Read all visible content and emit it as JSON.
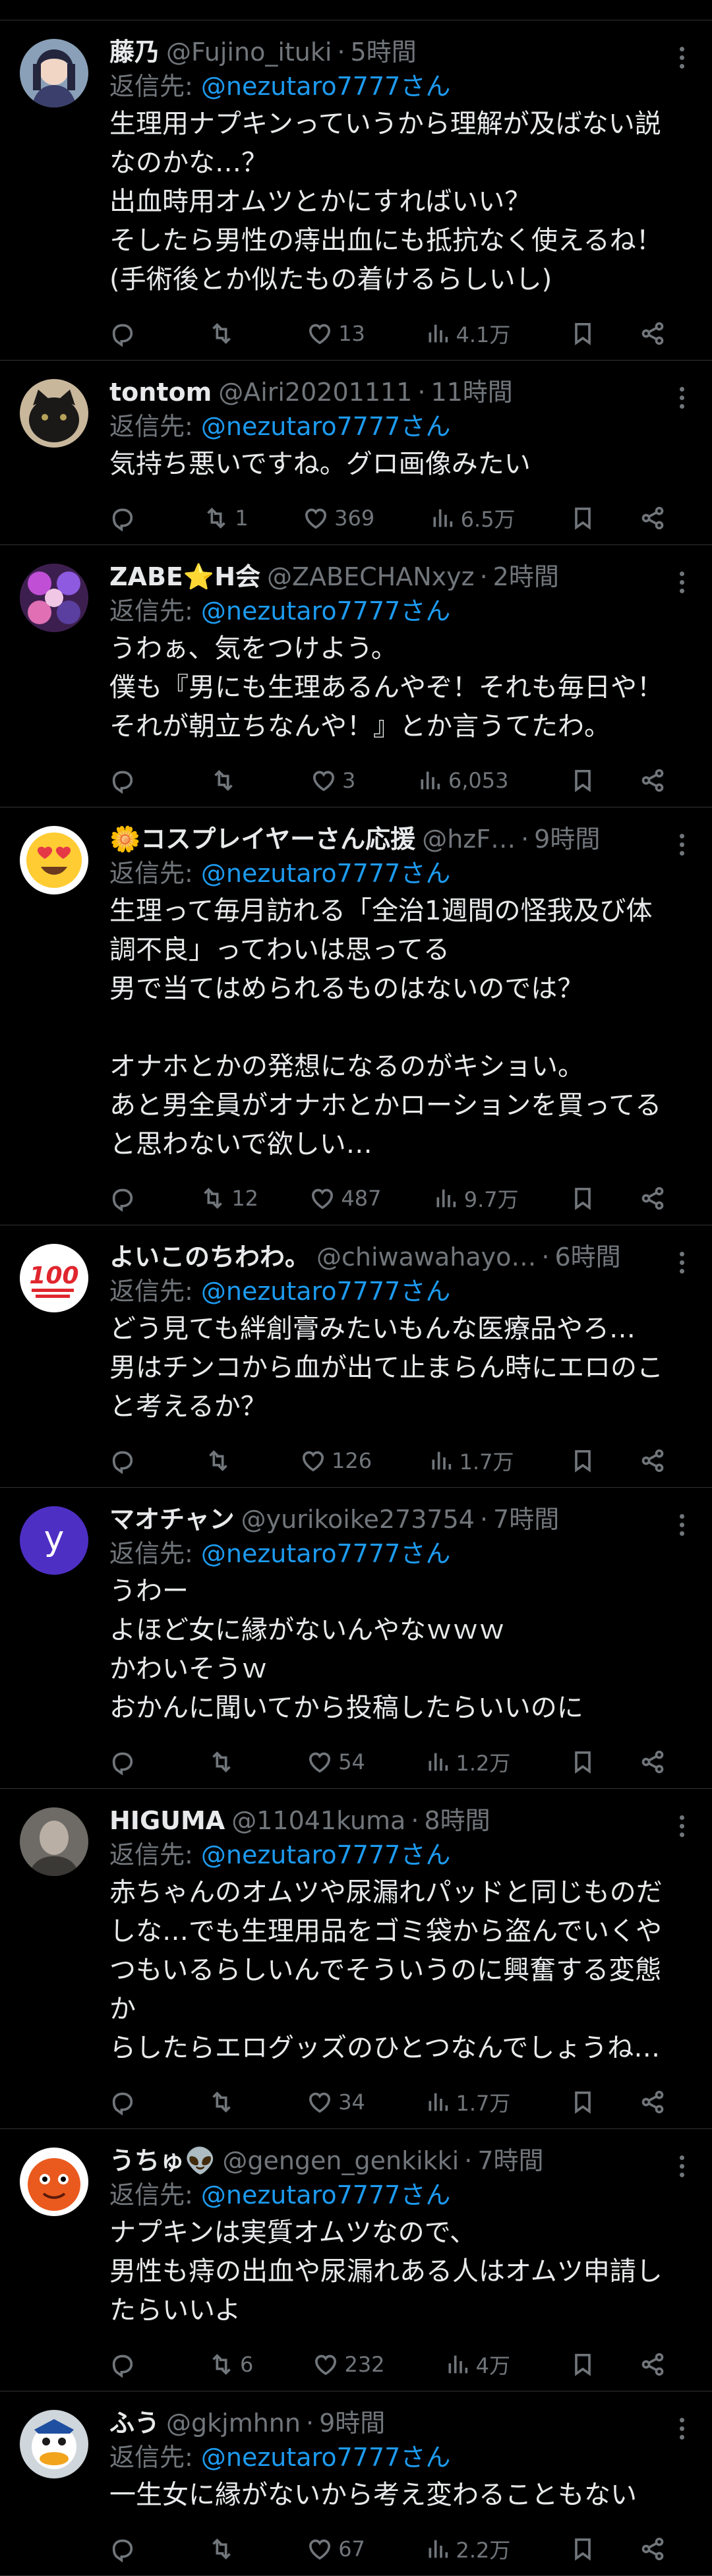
{
  "tweets": [
    {
      "name": "藤乃",
      "handle": "@Fujino_ituki",
      "time": "5時間",
      "reply_prefix": "返信先: ",
      "reply_to": "@nezutaro7777さん",
      "lines": [
        "生理用ナプキンっていうから理解が及ばない説",
        "なのかな…？",
        "出血時用オムツとかにすればいい？",
        "そしたら男性の痔出血にも抵抗なく使えるね！",
        "(手術後とか似たもの着けるらしいし)"
      ],
      "replies": "",
      "retweets": "",
      "likes": "13",
      "views": "4.1万",
      "avatar": "anime-character-dark-hair"
    },
    {
      "name": "tontom",
      "handle": "@Airi20201111",
      "time": "11時間",
      "reply_prefix": "返信先: ",
      "reply_to": "@nezutaro7777さん",
      "lines": [
        "気持ち悪いですね。グロ画像みたい"
      ],
      "replies": "",
      "retweets": "1",
      "likes": "369",
      "views": "6.5万",
      "avatar": "black-cat-photo"
    },
    {
      "name": "ZABE⭐H会",
      "handle": "@ZABECHANxyz",
      "time": "2時間",
      "reply_prefix": "返信先: ",
      "reply_to": "@nezutaro7777さん",
      "lines": [
        "うわぁ、気をつけよう。",
        "僕も『男にも生理あるんやぞ！それも毎日や！",
        "それが朝立ちなんや！』とか言うてたわ。"
      ],
      "replies": "",
      "retweets": "",
      "likes": "3",
      "views": "6,053",
      "avatar": "purple-anime-art"
    },
    {
      "name": "🌼コスプレイヤーさん応援",
      "handle": "@hzF…",
      "time": "9時間",
      "reply_prefix": "返信先: ",
      "reply_to": "@nezutaro7777さん",
      "lines": [
        "生理って毎月訪れる「全治1週間の怪我及び体",
        "調不良」ってわいは思ってる",
        "男で当てはめられるものはないのでは？",
        "",
        "オナホとかの発想になるのがキショい。",
        "あと男全員がオナホとかローションを買ってる",
        "と思わないで欲しい…"
      ],
      "replies": "",
      "retweets": "12",
      "likes": "487",
      "views": "9.7万",
      "avatar": "heart-eyes-emoji"
    },
    {
      "name": "よいこのちわわ。",
      "handle": "@chiwawahayo…",
      "time": "6時間",
      "reply_prefix": "返信先: ",
      "reply_to": "@nezutaro7777さん",
      "lines": [
        "どう見ても絆創膏みたいもんな医療品やろ…",
        "男はチンコから血が出て止まらん時にエロのこ",
        "と考えるか？"
      ],
      "replies": "",
      "retweets": "",
      "likes": "126",
      "views": "1.7万",
      "avatar": "hundred-points-emoji"
    },
    {
      "name": "マオチャン",
      "handle": "@yurikoike273754",
      "time": "7時間",
      "reply_prefix": "返信先: ",
      "reply_to": "@nezutaro7777さん",
      "lines": [
        "うわー",
        "よほど女に縁がないんやなｗｗｗ",
        "かわいそうｗ",
        "おかんに聞いてから投稿したらいいのに"
      ],
      "replies": "",
      "retweets": "",
      "likes": "54",
      "views": "1.2万",
      "avatar": "letter-y-default",
      "avatar_letter": "y"
    },
    {
      "name": "HIGUMA",
      "handle": "@11041kuma",
      "time": "8時間",
      "reply_prefix": "返信先: ",
      "reply_to": "@nezutaro7777さん",
      "lines": [
        "赤ちゃんのオムツや尿漏れパッドと同じものだ",
        "しな…でも生理用品をゴミ袋から盗んでいくや",
        "つもいるらしいんでそういうのに興奮する変態か",
        "らしたらエログッズのひとつなんでしょうね…"
      ],
      "replies": "",
      "retweets": "",
      "likes": "34",
      "views": "1.7万",
      "avatar": "grey-figure-photo"
    },
    {
      "name": "うちゅ👽",
      "handle": "@gengen_genkikki",
      "time": "7時間",
      "reply_prefix": "返信先: ",
      "reply_to": "@nezutaro7777さん",
      "lines": [
        "ナプキンは実質オムツなので、",
        "男性も痔の出血や尿漏れある人はオムツ申請し",
        "たらいいよ"
      ],
      "replies": "",
      "retweets": "6",
      "likes": "232",
      "views": "4万",
      "avatar": "orange-character"
    },
    {
      "name": "ふう",
      "handle": "@gkjmhnn",
      "time": "9時間",
      "reply_prefix": "返信先: ",
      "reply_to": "@nezutaro7777さん",
      "lines": [
        "一生女に縁がないから考え変わることもない"
      ],
      "replies": "",
      "retweets": "",
      "likes": "67",
      "views": "2.2万",
      "avatar": "cartoon-duck"
    }
  ],
  "icons": {
    "reply": "reply-icon",
    "retweet": "retweet-icon",
    "like": "heart-icon",
    "views": "views-bar-chart-icon",
    "bookmark": "bookmark-icon",
    "share": "share-icon",
    "more": "more-options-icon"
  },
  "colors": {
    "background": "#000000",
    "text": "#e7e9ea",
    "muted": "#71767b",
    "link": "#1d9bf0",
    "divider": "#2f3336"
  }
}
